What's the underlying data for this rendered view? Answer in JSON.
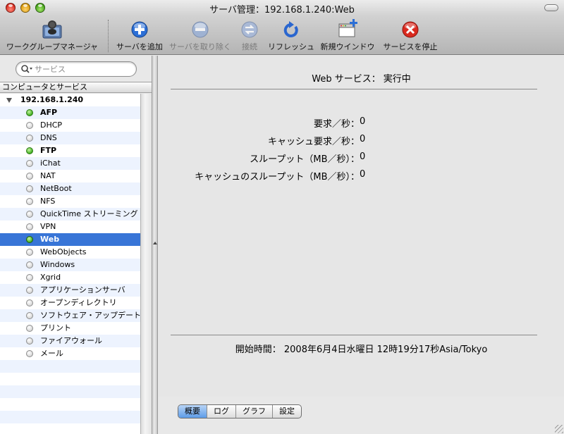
{
  "window": {
    "title": "サーバ管理：192.168.1.240:Web"
  },
  "toolbar": {
    "workgroup_manager": {
      "label": "ワークグループマネージャ",
      "icon": "workgroup-manager-icon"
    },
    "add_server": {
      "label": "サーバを追加",
      "icon": "plus-circle-icon"
    },
    "remove_server": {
      "label": "サーバを取り除く",
      "icon": "minus-circle-icon"
    },
    "connect": {
      "label": "接続",
      "icon": "connect-icon"
    },
    "refresh": {
      "label": "リフレッシュ",
      "icon": "refresh-icon"
    },
    "new_window": {
      "label": "新規ウインドウ",
      "icon": "new-window-icon"
    },
    "stop_service": {
      "label": "サービスを停止",
      "icon": "stop-x-icon"
    }
  },
  "sidebar": {
    "search_placeholder": "サービス",
    "header": "コンピュータとサービス",
    "server": "192.168.1.240",
    "services": [
      {
        "label": "AFP",
        "running": true
      },
      {
        "label": "DHCP",
        "running": false
      },
      {
        "label": "DNS",
        "running": false
      },
      {
        "label": "FTP",
        "running": true
      },
      {
        "label": "iChat",
        "running": false
      },
      {
        "label": "NAT",
        "running": false
      },
      {
        "label": "NetBoot",
        "running": false
      },
      {
        "label": "NFS",
        "running": false
      },
      {
        "label": "QuickTime ストリーミング",
        "running": false
      },
      {
        "label": "VPN",
        "running": false
      },
      {
        "label": "Web",
        "running": true,
        "selected": true
      },
      {
        "label": "WebObjects",
        "running": false
      },
      {
        "label": "Windows",
        "running": false
      },
      {
        "label": "Xgrid",
        "running": false
      },
      {
        "label": "アプリケーションサーバ",
        "running": false
      },
      {
        "label": "オープンディレクトリ",
        "running": false
      },
      {
        "label": "ソフトウェア・アップデート",
        "running": false
      },
      {
        "label": "プリント",
        "running": false
      },
      {
        "label": "ファイアウォール",
        "running": false
      },
      {
        "label": "メール",
        "running": false
      }
    ]
  },
  "main": {
    "status": {
      "label": "Web サービス：",
      "value": "実行中"
    },
    "stats": [
      {
        "label": "要求／秒：",
        "value": "0"
      },
      {
        "label": "キャッシュ要求／秒：",
        "value": "0"
      },
      {
        "label": "スループット（MB／秒）：",
        "value": "0"
      },
      {
        "label": "キャッシュのスループット（MB／秒）：",
        "value": "0"
      }
    ],
    "start_time": {
      "label": "開始時間：",
      "value": "2008年6月4日水曜日 12時19分17秒Asia/Tokyo"
    },
    "tabs": [
      {
        "label": "概要",
        "active": true
      },
      {
        "label": "ログ",
        "active": false
      },
      {
        "label": "グラフ",
        "active": false
      },
      {
        "label": "設定",
        "active": false
      }
    ]
  },
  "colors": {
    "selection": "#3875d7",
    "running": "#3fae1f",
    "stripe": "#edf3fe",
    "add_blue": "#2c6fd6",
    "stop_red": "#d92a1f"
  }
}
